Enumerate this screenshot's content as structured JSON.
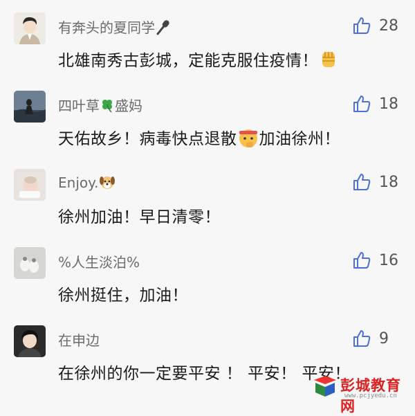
{
  "comments": [
    {
      "name": "有奔头的夏同学",
      "name_icon": "microphone-icon",
      "text": "北雄南秀古彭城，定能克服住疫情！",
      "text_emoji": "raised-fist-icon",
      "likes": "28"
    },
    {
      "name_prefix": "四叶草",
      "name_icon": "four-leaf-clover-icon",
      "name_suffix": "盛妈",
      "text_before": "天佑故乡！病毒快点退散",
      "text_emoji": "fighting-face-icon",
      "text_after": "加油徐州！",
      "likes": "18"
    },
    {
      "name": "Enjoy.",
      "name_icon": "dog-face-icon",
      "text": "徐州加油！早日清零！",
      "likes": "18"
    },
    {
      "name": "%人生淡泊%",
      "text": "徐州挺住，加油！",
      "likes": "16"
    },
    {
      "name": "在申边",
      "text": "在徐州的你一定要平安 ！ 平安！ 平安！",
      "likes": "9"
    }
  ],
  "watermark": {
    "title": "彭城教育网",
    "url": "www.pcjyedu.cn"
  },
  "colors": {
    "background": "#f7f7f7",
    "name": "#6b6b6b",
    "text": "#1a1a1a",
    "watermark": "#dd2222"
  }
}
